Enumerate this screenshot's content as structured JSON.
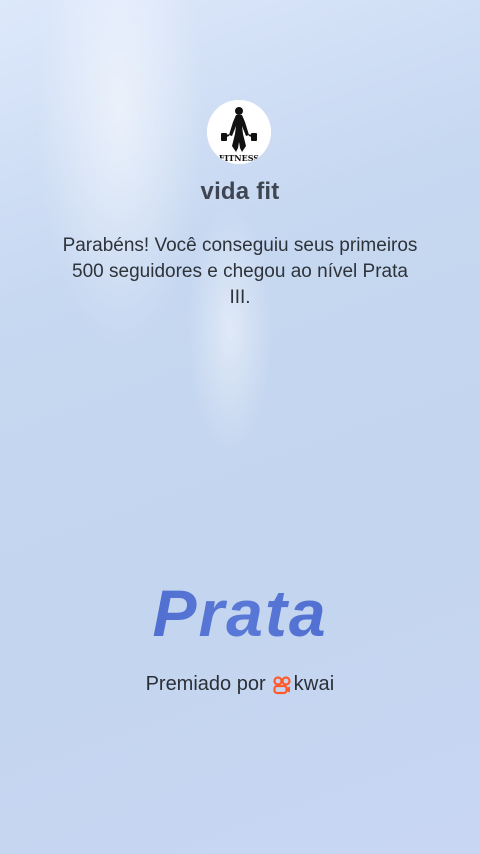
{
  "profile": {
    "username": "vida fit",
    "avatar_text": "FITNESS",
    "avatar_icon": "fitness-woman-silhouette"
  },
  "message": "Parabéns! Você conseguiu seus primeiros 500 seguidores e chegou ao nível Prata III.",
  "level": {
    "title": "Prata"
  },
  "award": {
    "prefix": "Premiado por",
    "brand": "kwai",
    "brand_icon": "kwai-logo",
    "brand_color": "#ff5a2b"
  },
  "colors": {
    "level_accent": "#4668cf",
    "background": "#c7d8f1"
  }
}
